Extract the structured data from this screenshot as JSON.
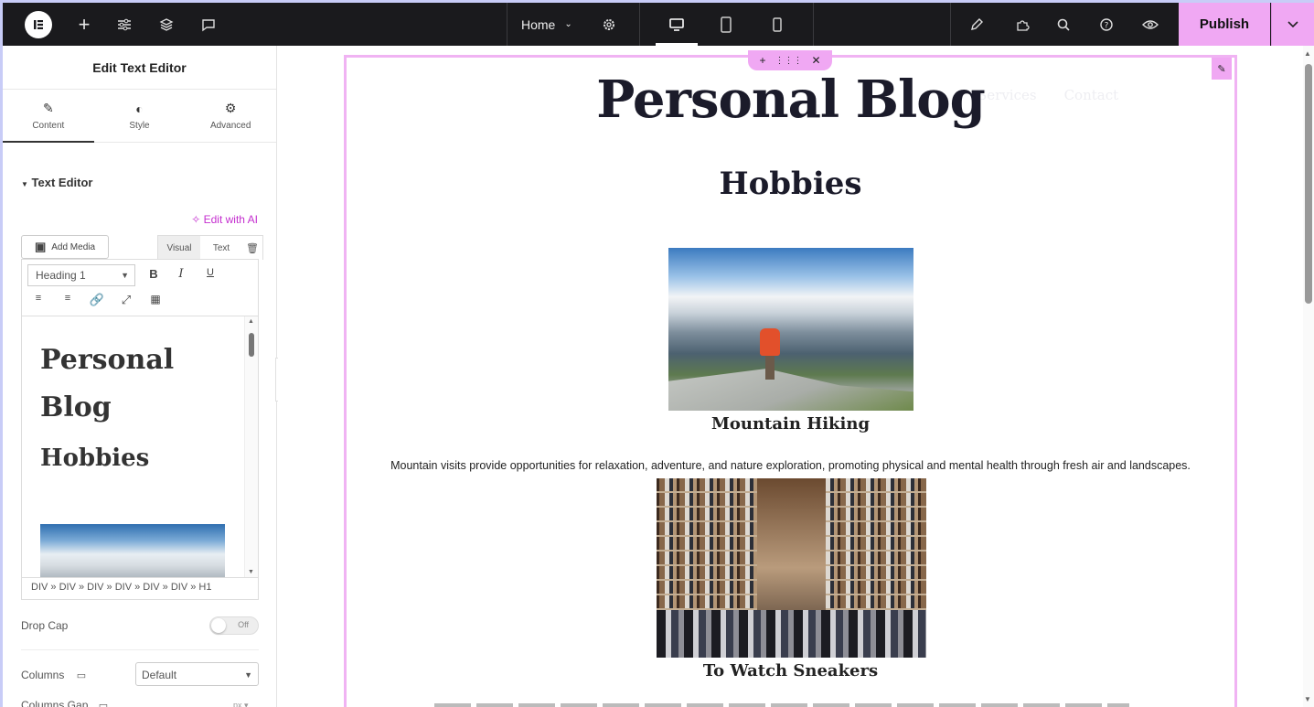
{
  "topbar": {
    "home_label": "Home",
    "publish_label": "Publish"
  },
  "panel": {
    "title": "Edit Text Editor",
    "tabs": [
      {
        "label": "Content",
        "icon": "pencil-icon"
      },
      {
        "label": "Style",
        "icon": "half-circle-icon"
      },
      {
        "label": "Advanced",
        "icon": "gear-icon"
      }
    ],
    "section_title": "Text Editor",
    "edit_ai_label": "Edit with AI",
    "add_media_label": "Add Media",
    "visual_label": "Visual",
    "text_label": "Text",
    "format_value": "Heading 1",
    "editor_h1": "Personal Blog",
    "editor_h2": "Hobbies",
    "breadcrumb": "DIV » DIV » DIV » DIV » DIV » DIV » H1",
    "drop_cap_label": "Drop Cap",
    "drop_cap_value": "Off",
    "columns_label": "Columns",
    "columns_value": "Default",
    "columns_gap_label": "Columns Gap",
    "columns_gap_unit": "px"
  },
  "page": {
    "title": "Personal Blog",
    "menu": [
      "Services",
      "Contact"
    ],
    "heading": "Hobbies",
    "item1_caption": "Mountain Hiking",
    "item1_desc": "Mountain visits provide opportunities for relaxation, adventure, and nature exploration, promoting physical and mental health through fresh air and landscapes.",
    "item2_caption": "To Watch Sneakers"
  },
  "colors": {
    "accent": "#f0a8f3",
    "topbar_bg": "#1a1a1d",
    "ai_link": "#c42ecf"
  }
}
